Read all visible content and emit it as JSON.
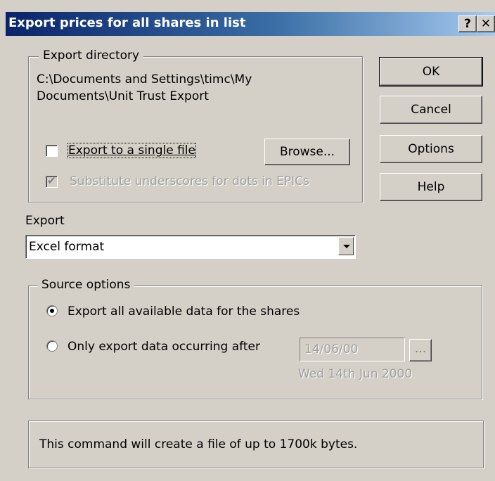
{
  "dialog": {
    "title": "Export prices for all shares in list",
    "help_glyph": "?",
    "close_glyph": "✕"
  },
  "export_directory": {
    "group_label": "Export directory",
    "path_line1": "C:\\Documents and Settings\\timc\\My",
    "path_line2": "Documents\\Unit Trust Export",
    "single_file_label": "Export to a single file",
    "single_file_checked": false,
    "browse_label": "Browse...",
    "substitute_label": "Substitute underscores for dots in EPICs",
    "substitute_checked": true
  },
  "buttons": {
    "ok": "OK",
    "cancel": "Cancel",
    "options": "Options",
    "help": "Help"
  },
  "export": {
    "label": "Export",
    "selected": "Excel format"
  },
  "source_options": {
    "group_label": "Source options",
    "all_data_label": "Export all available data for the shares",
    "after_label": "Only export data occurring after",
    "date_value": "14/06/00",
    "date_button": "...",
    "date_long": "Wed 14th Jun 2000",
    "selected": "all"
  },
  "status": {
    "message": "This command will create a file of up to 1700k bytes."
  }
}
